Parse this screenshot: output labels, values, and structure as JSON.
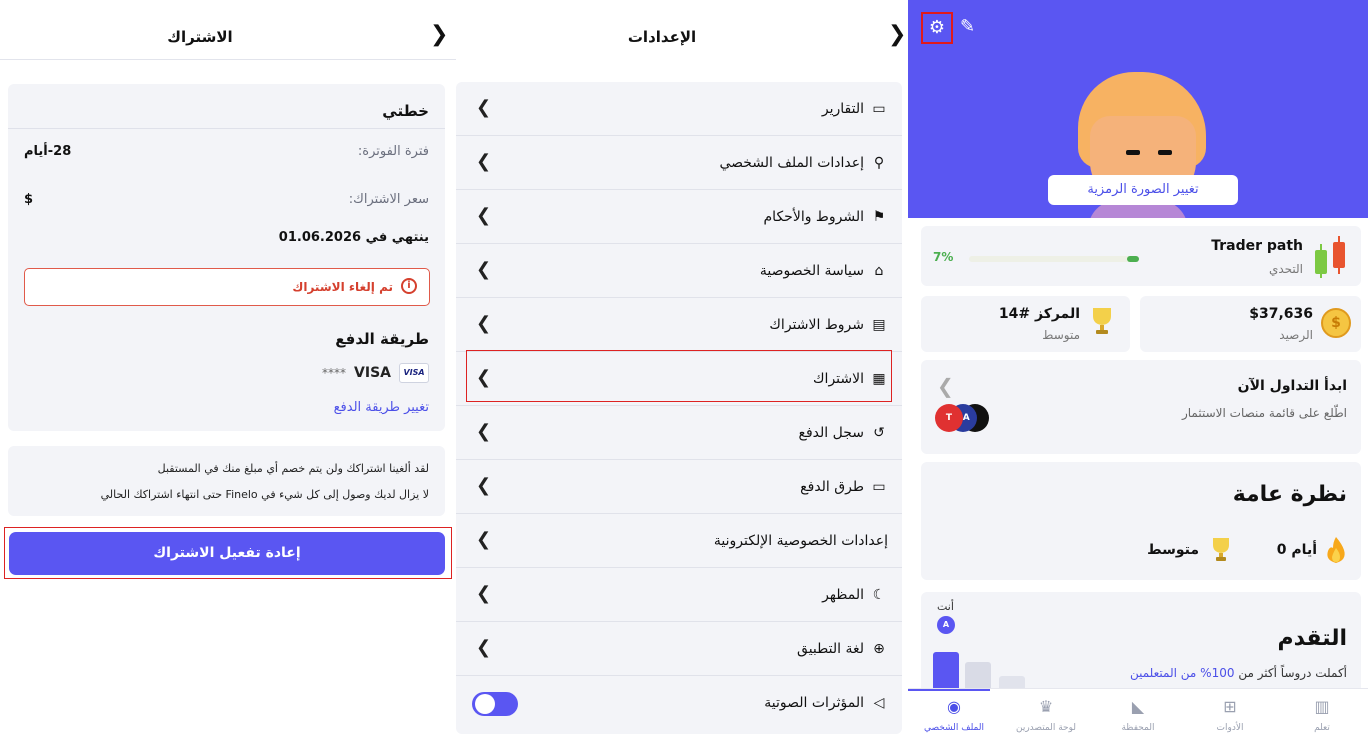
{
  "subscription": {
    "title": "الاشتراك",
    "back_icon": "chevron-right-icon",
    "plan_heading": "خطتي",
    "billing_label": "فترة الفوترة:",
    "billing_value": "28-أيام",
    "price_label": "سعر الاشتراك:",
    "price_value": "$",
    "ends_text": "ينتهي في 01.06.2026",
    "cancelled_text": "تم إلغاء الاشتراك",
    "cancelled_color": "#d5402e",
    "payment_heading": "طريقة الدفع",
    "card_badge": "VISA",
    "card_name": "VISA",
    "card_masked": "****",
    "change_payment": "تغيير طريقة الدفع",
    "notice_line1": "لقد ألغينا اشتراكك ولن يتم خصم أي مبلغ منك في المستقبل",
    "notice_line2": "لا يزال لديك وصول إلى كل شيء في Finelo حتى انتهاء اشتراكك الحالي",
    "reactivate_button": "إعادة تفعيل الاشتراك",
    "accent": "#5a56f2"
  },
  "settings": {
    "title": "الإعدادات",
    "items": [
      {
        "label": "التقارير",
        "icon": "folder-icon"
      },
      {
        "label": "إعدادات الملف الشخصي",
        "icon": "user-search-icon"
      },
      {
        "label": "الشروط والأحكام",
        "icon": "flag-icon"
      },
      {
        "label": "سياسة الخصوصية",
        "icon": "lock-icon"
      },
      {
        "label": "شروط الاشتراك",
        "icon": "document-icon"
      },
      {
        "label": "الاشتراك",
        "icon": "receipt-icon"
      },
      {
        "label": "سجل الدفع",
        "icon": "history-icon"
      },
      {
        "label": "طرق الدفع",
        "icon": "credit-card-icon"
      },
      {
        "label": "إعدادات الخصوصية الإلكترونية",
        "icon": ""
      },
      {
        "label": "المظهر",
        "icon": "moon-icon"
      },
      {
        "label": "لغة التطبيق",
        "icon": "globe-icon"
      },
      {
        "label": "المؤثرات الصوتية",
        "icon": "speaker-icon",
        "toggle_on": true
      }
    ]
  },
  "profile": {
    "settings_icon": "gear-icon",
    "edit_icon": "pencil-icon",
    "change_avatar": "تغيير الصورة الرمزية",
    "trader_path": "Trader path",
    "challenge": "التحدي",
    "trader_progress_text": "7%",
    "trader_progress": 0.07,
    "balance_value": "$37,636",
    "balance_label": "الرصيد",
    "rank_value": "المركز #14",
    "rank_label": "متوسط",
    "trade_title": "ابدأ التداول الآن",
    "trade_sub": "اطّلع على قائمة منصات الاستثمار",
    "overview_title": "نظرة عامة",
    "streak": "0 أيام",
    "level": "متوسط",
    "progress_title": "التقدم",
    "progress_text": "أكملت دروساً أكثر من",
    "progress_highlight": "100% من المتعلمين",
    "you_label": "أنت",
    "you_avatar": "A",
    "nav": [
      {
        "label": "الملف الشخصي",
        "icon": "profile-icon",
        "active": true
      },
      {
        "label": "لوحة المتصدرين",
        "icon": "trophy-icon",
        "active": false
      },
      {
        "label": "المحفظة",
        "icon": "chart-icon",
        "active": false
      },
      {
        "label": "الأدوات",
        "icon": "tools-icon",
        "active": false
      },
      {
        "label": "تعلم",
        "icon": "book-icon",
        "active": false
      }
    ]
  }
}
